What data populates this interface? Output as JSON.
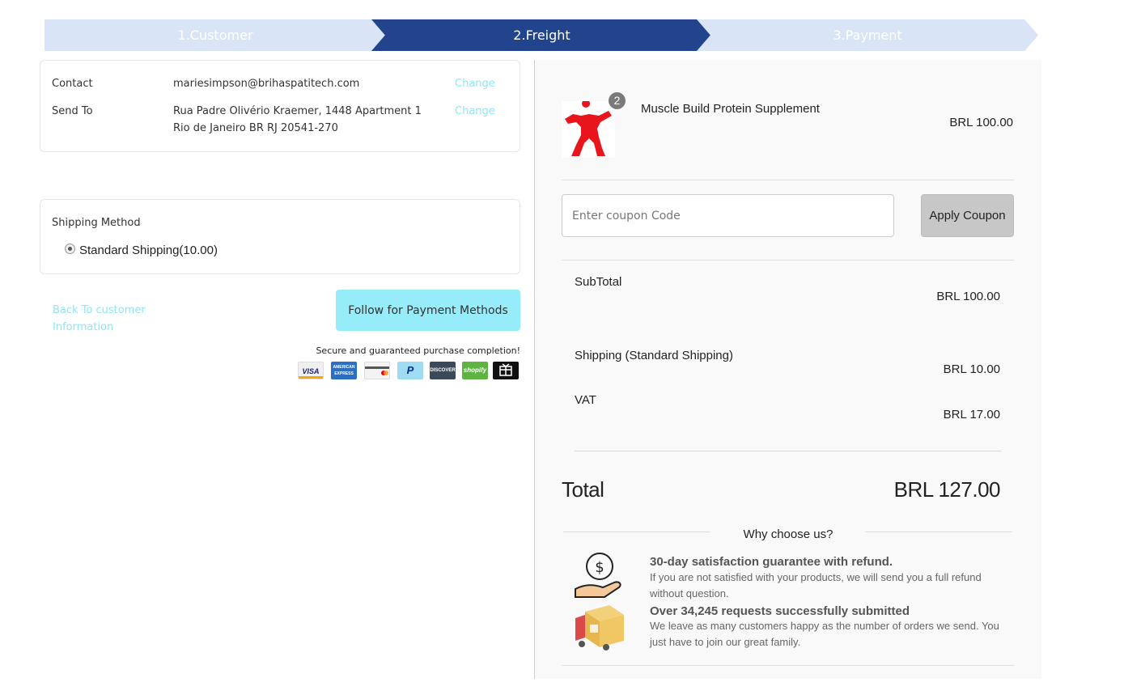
{
  "steps": [
    {
      "label": "1.Customer",
      "state": "done"
    },
    {
      "label": "2.Freight",
      "state": "active"
    },
    {
      "label": "3.Payment",
      "state": "pending"
    }
  ],
  "contact": {
    "label": "Contact",
    "value": "mariesimpson@brihaspatitech.com",
    "change_label": "Change"
  },
  "send_to": {
    "label": "Send To",
    "line1": "Rua Padre Olivério Kraemer, 1448 Apartment 1",
    "line2": "Rio de Janeiro BR RJ 20541-270",
    "change_label": "Change"
  },
  "shipping": {
    "title": "Shipping Method",
    "option": "Standard Shipping(10.00)"
  },
  "actions": {
    "back_label": "Back To customer Information",
    "follow_label": "Follow for Payment Methods",
    "secure_text": "Secure and guaranteed purchase completion!"
  },
  "payment_icons": [
    "visa-icon",
    "amex-icon",
    "card-icon",
    "paypal-icon",
    "discover-icon",
    "shopify-icon",
    "gift-card-icon"
  ],
  "payment_labels": {
    "visa": "VISA",
    "amex": "AMERICAN EXPRESS",
    "paypal": "P",
    "discover": "DISCOVER",
    "shopify": "shopify"
  },
  "summary": {
    "product": {
      "name": "Muscle Build Protein Supplement",
      "qty": "2",
      "price": "BRL 100.00"
    },
    "coupon": {
      "placeholder": "Enter coupon Code",
      "button": "Apply Coupon"
    },
    "subtotal": {
      "label": "SubTotal",
      "value": "BRL 100.00"
    },
    "shipping": {
      "label": "Shipping (Standard Shipping)",
      "value": "BRL 10.00"
    },
    "vat": {
      "label": "VAT",
      "value": "BRL 17.00"
    },
    "total": {
      "label": "Total",
      "value": "BRL 127.00"
    },
    "why": "Why choose us?",
    "features": [
      {
        "title": "30-day satisfaction guarantee with refund.",
        "text": "If you are not satisfied with your products, we will send you a full refund without question."
      },
      {
        "title": "Over 34,245 requests successfully submitted",
        "text": "We leave as many customers happy as the number of orders we send. You just have to join our great family."
      }
    ]
  },
  "colors": {
    "active_step": "#22448c",
    "inactive_step": "#d9e4f7",
    "link": "#8ee6f5",
    "primary_button": "#96ecf8"
  }
}
